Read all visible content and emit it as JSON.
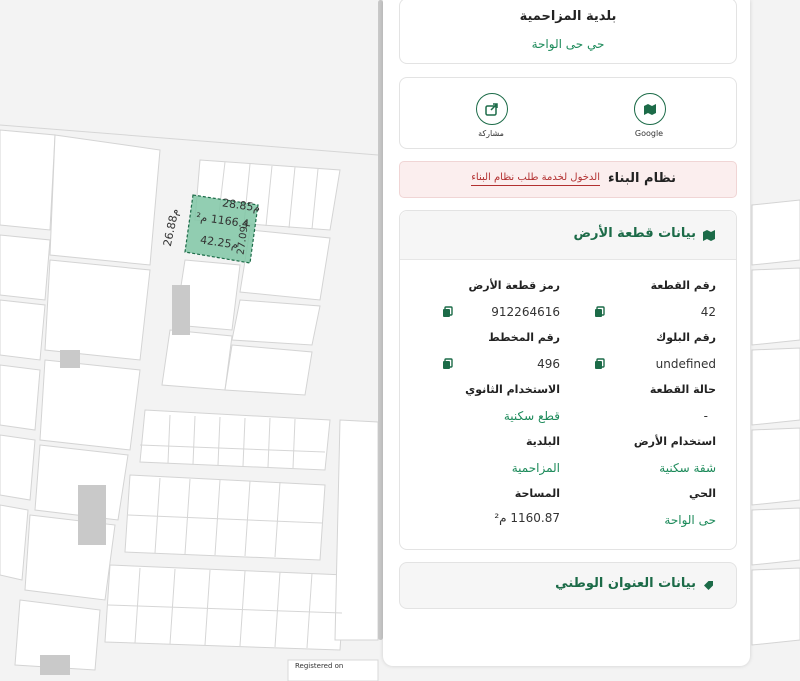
{
  "municipality_card": {
    "title": "بلدية المزاحمية",
    "district": "حي حى الواحة"
  },
  "actions": {
    "share_label": "مشاركة",
    "google_label": "Google"
  },
  "building_system": {
    "title": "نظام البناء",
    "link": "الدخول لخدمة طلب نظام البناء"
  },
  "land_data": {
    "title": "بيانات قطعة الأرض",
    "plot_number_label": "رقم القطعة",
    "plot_number": "42",
    "land_code_label": "رمز قطعة الأرض",
    "land_code": "912264616",
    "block_number_label": "رقم البلوك",
    "block_number": "undefined",
    "plan_number_label": "رقم المخطط",
    "plan_number": "496",
    "plot_status_label": "حالة القطعة",
    "plot_status": "-",
    "secondary_use_label": "الاستخدام الثانوي",
    "secondary_use": "قطع سكنية",
    "land_use_label": "استخدام الأرض",
    "land_use": "شقة سكنية",
    "municipality_label": "البلدية",
    "municipality": "المزاحمية",
    "district_label": "الحي",
    "district": "حى الواحة",
    "area_label": "المساحة",
    "area": "1160.87 م²"
  },
  "national_address": {
    "title": "بيانات العنوان الوطني"
  },
  "map": {
    "dim_top": "28.85م",
    "dim_area": "1166.4 م²",
    "dim_right": "27.09م",
    "dim_bottom": "42.25م",
    "dim_left": "26.88م",
    "registered_text": "Registered on"
  },
  "colors": {
    "accent_green": "#1c6b48",
    "value_green": "#1c8a5a",
    "alert_bg": "#fbeeee",
    "alert_text": "#b23030",
    "plot_fill": "#7fc6a4"
  }
}
